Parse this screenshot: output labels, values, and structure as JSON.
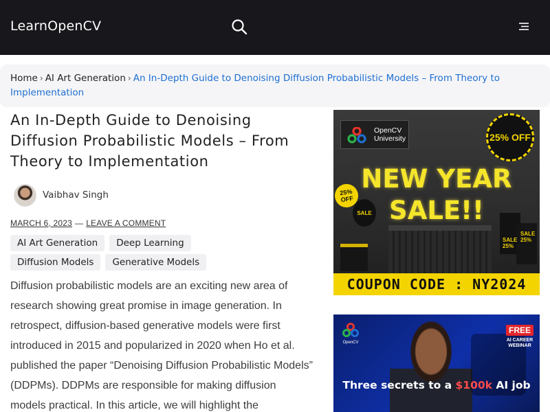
{
  "header": {
    "logo_text": "LearnOpenCV",
    "search_icon": "search-icon",
    "menu_icon": "hamburger-menu-icon"
  },
  "breadcrumb": {
    "items": [
      "Home",
      "AI Art Generation"
    ],
    "separator": "›",
    "current": "An In-Depth Guide to Denoising Diffusion Probabilistic Models – From Theory to Implementation"
  },
  "article": {
    "title": "An In-Depth Guide to Denoising Diffusion Probabilistic Models – From Theory to Implementation",
    "author": "Vaibhav Singh",
    "date": "MARCH 6, 2023",
    "dash": "—",
    "comment_link": "LEAVE A COMMENT",
    "tags": [
      "AI Art Generation",
      "Deep Learning",
      "Diffusion Models",
      "Generative Models"
    ],
    "body": "Diffusion probabilistic models are an exciting new area of research showing great promise in image generation. In retrospect, diffusion-based generative models were first introduced in 2015 and popularized in 2020 when Ho et al. published the paper “Denoising Diffusion Probabilistic Models” (DDPMs). DDPMs are responsible for making diffusion models practical. In this article, we will highlight the"
  },
  "ads": {
    "sale": {
      "brand": "OpenCV University",
      "badge": "25% OFF",
      "headline_1": "NEW YEAR",
      "headline_2": "SALE!!",
      "balloon": "25% OFF",
      "balloon_2": "SALE",
      "bag_1": "SALE 25%",
      "bag_2": "SALE 25%",
      "coupon": "COUPON CODE : NY2024",
      "accent_color": "#f3d400"
    },
    "webinar": {
      "brand": "OpenCV",
      "badge": "FREE",
      "badge_sub": "AI CAREER WEBINAR",
      "tagline_pre": "Three secrets to a ",
      "tagline_highlight": "$100k",
      "tagline_post": " AI job",
      "accent_color": "#e3262b"
    }
  },
  "colors": {
    "header_bg": "#17171c",
    "link_blue": "#1f6fd1",
    "tag_bg": "#f0f0f2"
  }
}
